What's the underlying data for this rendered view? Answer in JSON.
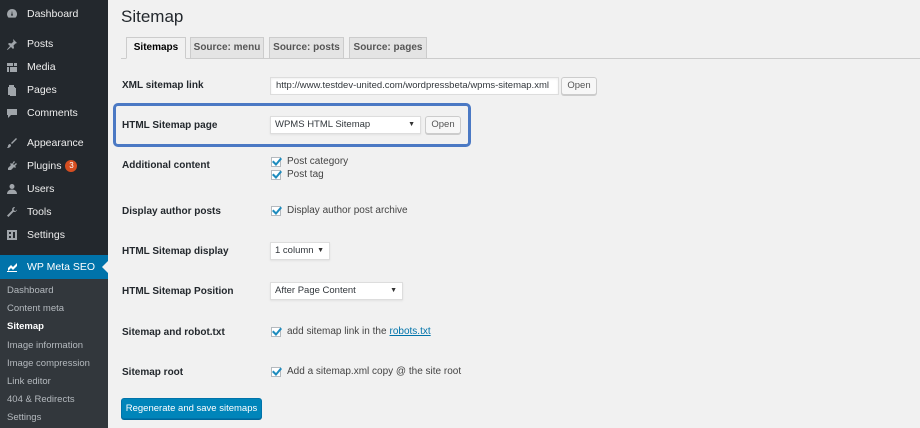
{
  "sidebar": {
    "items": [
      {
        "label": "Dashboard",
        "icon": "dashboard-icon"
      },
      {
        "label": "Posts",
        "icon": "pin-icon"
      },
      {
        "label": "Media",
        "icon": "media-icon"
      },
      {
        "label": "Pages",
        "icon": "pages-icon"
      },
      {
        "label": "Comments",
        "icon": "comment-icon"
      },
      {
        "label": "Appearance",
        "icon": "brush-icon"
      },
      {
        "label": "Plugins",
        "icon": "plug-icon",
        "badge": "3"
      },
      {
        "label": "Users",
        "icon": "user-icon"
      },
      {
        "label": "Tools",
        "icon": "wrench-icon"
      },
      {
        "label": "Settings",
        "icon": "settings-icon"
      }
    ],
    "active_plugin": {
      "label": "WP Meta SEO",
      "icon": "chart-icon"
    },
    "submenu": [
      "Dashboard",
      "Content meta",
      "Sitemap",
      "Image information",
      "Image compression",
      "Link editor",
      "404 & Redirects",
      "Settings"
    ],
    "submenu_current": "Sitemap"
  },
  "page": {
    "title": "Sitemap"
  },
  "tabs": [
    "Sitemaps",
    "Source: menu",
    "Source: posts",
    "Source: pages"
  ],
  "form": {
    "xml_link": {
      "label": "XML sitemap link",
      "value": "http://www.testdev-united.com/wordpressbeta/wpms-sitemap.xml",
      "button": "Open"
    },
    "html_page": {
      "label": "HTML Sitemap page",
      "selected": "WPMS HTML Sitemap",
      "button": "Open"
    },
    "additional": {
      "label": "Additional content",
      "options": [
        "Post category",
        "Post tag"
      ]
    },
    "author_posts": {
      "label": "Display author posts",
      "option": "Display author post archive"
    },
    "display": {
      "label": "HTML Sitemap display",
      "selected": "1 column"
    },
    "position": {
      "label": "HTML Sitemap Position",
      "selected": "After Page Content"
    },
    "robot": {
      "label": "Sitemap and robot.txt",
      "option": "add sitemap link in the",
      "link": "robots.txt"
    },
    "root": {
      "label": "Sitemap root",
      "option": "Add a sitemap.xml copy @ the site root"
    },
    "submit": "Regenerate and save sitemaps"
  },
  "colors": {
    "sidebar_bg": "#23282d",
    "accent": "#0073aa",
    "highlight": "#4b79c4",
    "primary_button": "#0085ba"
  }
}
